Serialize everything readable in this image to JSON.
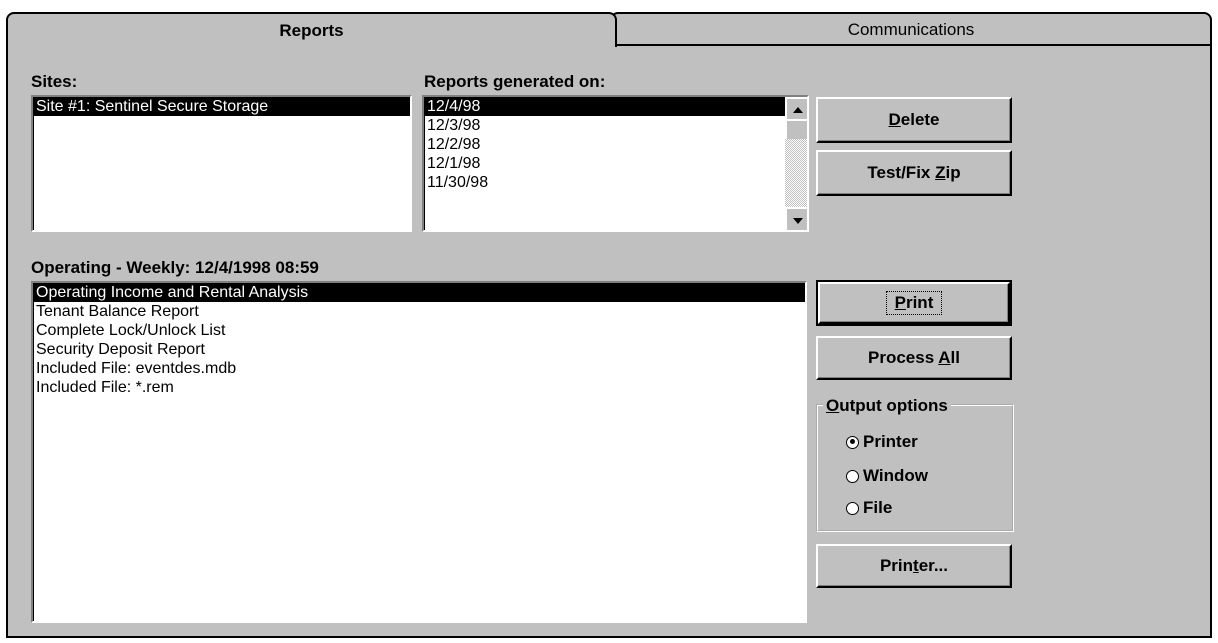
{
  "tabs": [
    {
      "label": "Reports"
    },
    {
      "label": "Communications"
    }
  ],
  "sites": {
    "label": "Sites:",
    "items": [
      "Site #1: Sentinel Secure Storage"
    ]
  },
  "reports_generated": {
    "label": "Reports generated on:",
    "items": [
      "12/4/98",
      "12/3/98",
      "12/2/98",
      "12/1/98",
      "11/30/98"
    ]
  },
  "report_set": {
    "label": "Operating - Weekly: 12/4/1998 08:59",
    "items": [
      "Operating Income and Rental Analysis",
      "Tenant Balance Report",
      "Complete Lock/Unlock List",
      "Security Deposit Report",
      "Included File: eventdes.mdb",
      "Included File: *.rem"
    ]
  },
  "buttons": {
    "delete": {
      "pre": "",
      "u": "D",
      "post": "elete"
    },
    "testfix": {
      "pre": "Test/Fix ",
      "u": "Z",
      "post": "ip"
    },
    "print": {
      "pre": "",
      "u": "P",
      "post": "rint"
    },
    "process_all": {
      "pre": "Process ",
      "u": "A",
      "post": "ll"
    },
    "printer_setup": {
      "pre": "Prin",
      "u": "t",
      "post": "er..."
    }
  },
  "output_options": {
    "title_u": "O",
    "title_rest": "utput options",
    "options": [
      "Printer",
      "Window",
      "File"
    ],
    "selected": "Printer"
  },
  "colors": {
    "face": "#c0c0c0",
    "selection": "#000000"
  }
}
